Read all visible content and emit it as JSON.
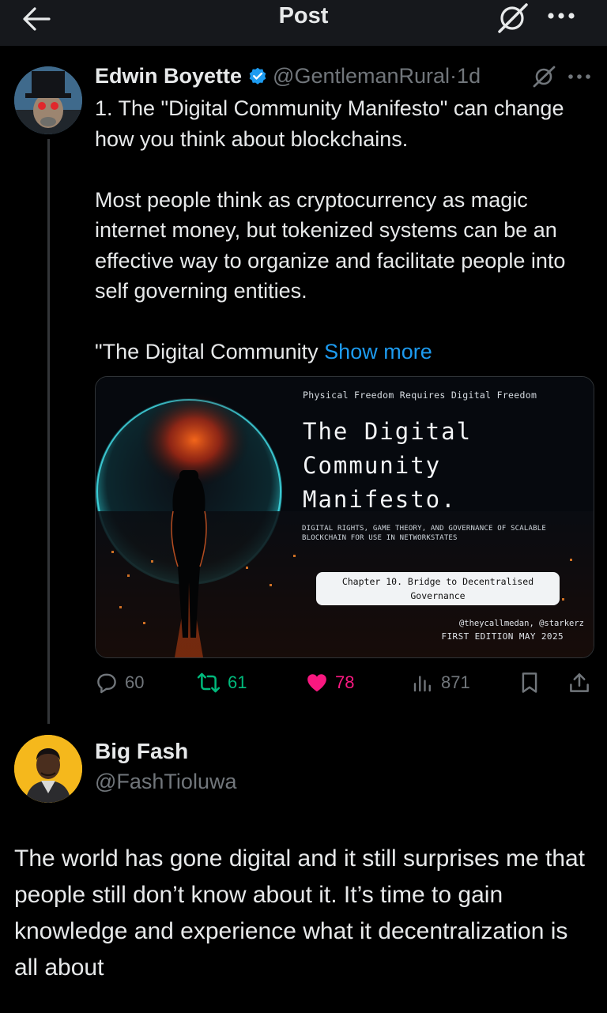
{
  "header": {
    "title": "Post"
  },
  "post": {
    "author_name": "Edwin Boyette",
    "author_handle": "@GentlemanRural",
    "separator": " · ",
    "time": "1d",
    "text_line_1": "1. The \"Digital Community Manifesto\" can change how you think about blockchains.",
    "text_line_2": "Most people think as cryptocurrency as magic internet money, but tokenized systems can be an effective way to organize and facilitate people into self governing entities.",
    "text_line_3": "\"The Digital Community ",
    "show_more": "Show more",
    "media": {
      "tagline": "Physical Freedom Requires Digital Freedom",
      "title_1": "The Digital",
      "title_2": "Community",
      "title_3": "Manifesto.",
      "subtitle": "DIGITAL RIGHTS, GAME THEORY, AND GOVERNANCE OF SCALABLE BLOCKCHAIN FOR USE IN NETWORKSTATES",
      "chapter": "Chapter 10. Bridge to Decentralised Governance",
      "authors": "@theycallmedan, @starkerz",
      "edition": "FIRST EDITION MAY 2025"
    },
    "stats": {
      "replies": "60",
      "reposts": "61",
      "likes": "78",
      "views": "871"
    }
  },
  "reply": {
    "author_name": "Big Fash",
    "author_handle": "@FashTioluwa",
    "text": "The world has gone digital and it still surprises me that people still don’t know about it. It’s time to gain knowledge and experience what it decentralization is all about"
  },
  "colors": {
    "background": "#000000",
    "accent_blue": "#1d9bf0",
    "repost_green": "#00ba7c",
    "like_pink": "#f91880",
    "muted_gray": "#71767b"
  },
  "icons": [
    "back-arrow-icon",
    "grok-icon",
    "more-icon",
    "verified-badge-icon",
    "reply-icon",
    "repost-icon",
    "heart-icon",
    "views-icon",
    "bookmark-icon",
    "share-icon"
  ]
}
